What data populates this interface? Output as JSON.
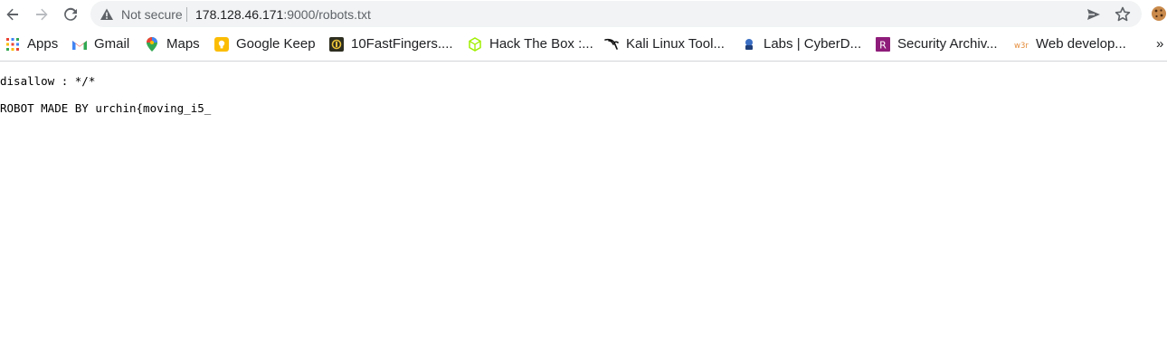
{
  "toolbar": {
    "back_icon": "arrow-left-icon",
    "forward_icon": "arrow-right-icon",
    "reload_icon": "reload-icon",
    "security_icon": "warning-triangle-icon",
    "security_label": "Not secure",
    "url_host": "178.128.46.171",
    "url_rest": ":9000/robots.txt",
    "send_icon": "send-icon",
    "star_icon": "star-icon",
    "extension_icon": "cookie-icon"
  },
  "bookmarks": {
    "items": [
      {
        "label": "Apps",
        "icon": "apps-grid-icon"
      },
      {
        "label": "Gmail",
        "icon": "gmail-icon"
      },
      {
        "label": "Maps",
        "icon": "maps-pin-icon"
      },
      {
        "label": "Google Keep",
        "icon": "keep-bulb-icon"
      },
      {
        "label": "10FastFingers....",
        "icon": "tenfastfingers-icon"
      },
      {
        "label": "Hack The Box :...",
        "icon": "hackthebox-cube-icon"
      },
      {
        "label": "Kali Linux Tool...",
        "icon": "kali-dragon-icon"
      },
      {
        "label": "Labs | CyberD...",
        "icon": "cyberdefenders-icon"
      },
      {
        "label": "Security Archiv...",
        "icon": "r-square-icon"
      },
      {
        "label": "Web develop...",
        "icon": "w3r-icon"
      }
    ],
    "overflow_label": "»"
  },
  "page": {
    "line1": "disallow : */*",
    "line2": "ROBOT MADE BY urchin{moving_i5_"
  },
  "colors": {
    "omnibox_bg": "#f1f3f4",
    "text_primary": "#202124",
    "text_secondary": "#5f6368"
  }
}
